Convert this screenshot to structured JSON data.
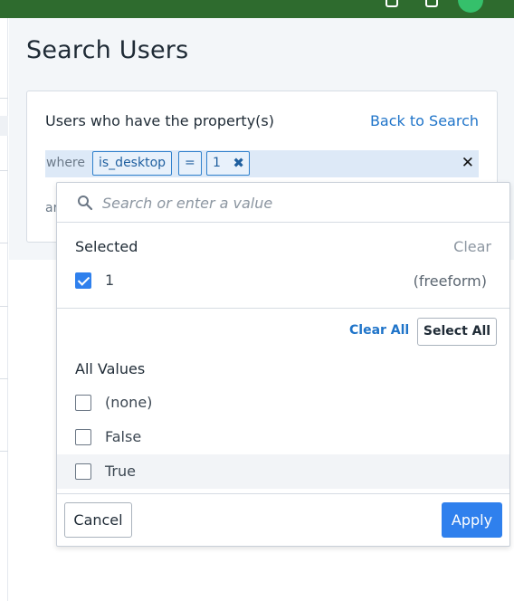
{
  "page": {
    "title": "Search Users"
  },
  "panel": {
    "heading": "Users who have the property(s)",
    "back_link": "Back to Search",
    "filter": {
      "where_label": "where",
      "property": "is_desktop",
      "operator": "=",
      "value": "1",
      "value_remove_glyph": "✖",
      "row_remove_glyph": "✕"
    },
    "and_label": "ar"
  },
  "dropdown": {
    "search_placeholder": "Search or enter a value",
    "search_value": "",
    "selected_title": "Selected",
    "clear_label": "Clear",
    "selected_items": [
      {
        "label": "1",
        "tag": "(freeform)",
        "checked": true
      }
    ],
    "clear_all_label": "Clear All",
    "select_all_label": "Select All",
    "all_values_title": "All Values",
    "all_values": [
      {
        "label": "(none)",
        "checked": false
      },
      {
        "label": "False",
        "checked": false
      },
      {
        "label": "True",
        "checked": false
      }
    ],
    "cancel_label": "Cancel",
    "apply_label": "Apply"
  },
  "colors": {
    "accent": "#2f80ed",
    "link": "#1f74c9",
    "topbar": "#2e6b2e"
  }
}
